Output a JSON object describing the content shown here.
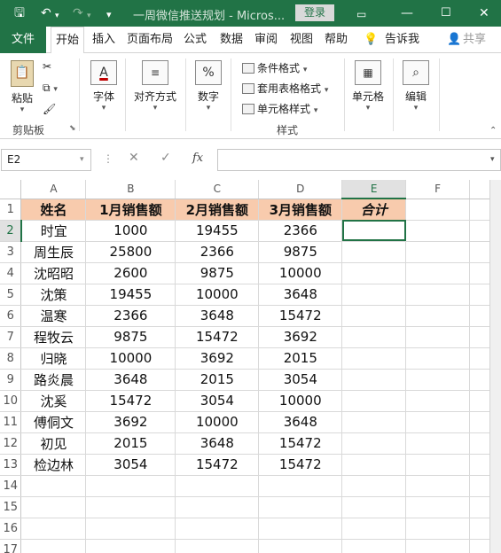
{
  "titlebar": {
    "title": "一周微信推送规划  -  Micros...",
    "login": "登录",
    "save_icon": "save-icon",
    "undo_icon": "undo-icon",
    "redo_icon": "redo-icon"
  },
  "tabs": {
    "file": "文件",
    "home": "开始",
    "insert": "插入",
    "page_layout": "页面布局",
    "formulas": "公式",
    "data": "数据",
    "review": "审阅",
    "view": "视图",
    "help": "帮助",
    "tell_me": "告诉我",
    "share": "共享"
  },
  "ribbon": {
    "paste": "粘贴",
    "clipboard": "剪贴板",
    "font": "字体",
    "alignment": "对齐方式",
    "number": "数字",
    "number_symbol": "%",
    "conditional_format": "条件格式",
    "table_format": "套用表格格式",
    "cell_styles": "单元格样式",
    "styles": "样式",
    "cells": "单元格",
    "editing": "编辑"
  },
  "formula_bar": {
    "name_box": "E2",
    "fx": "fx",
    "value": ""
  },
  "sheet": {
    "columns": [
      "A",
      "B",
      "C",
      "D",
      "E",
      "F"
    ],
    "header_row": [
      "姓名",
      "1月销售额",
      "2月销售额",
      "3月销售额",
      "合计"
    ],
    "rows": [
      [
        "时宜",
        "1000",
        "19455",
        "2366",
        ""
      ],
      [
        "周生辰",
        "25800",
        "2366",
        "9875",
        ""
      ],
      [
        "沈昭昭",
        "2600",
        "9875",
        "10000",
        ""
      ],
      [
        "沈策",
        "19455",
        "10000",
        "3648",
        ""
      ],
      [
        "温寒",
        "2366",
        "3648",
        "15472",
        ""
      ],
      [
        "程牧云",
        "9875",
        "15472",
        "3692",
        ""
      ],
      [
        "归晓",
        "10000",
        "3692",
        "2015",
        ""
      ],
      [
        "路炎晨",
        "3648",
        "2015",
        "3054",
        ""
      ],
      [
        "沈奚",
        "15472",
        "3054",
        "10000",
        ""
      ],
      [
        "傅侗文",
        "3692",
        "10000",
        "3648",
        ""
      ],
      [
        "初见",
        "2015",
        "3648",
        "15472",
        ""
      ],
      [
        "检边林",
        "3054",
        "15472",
        "15472",
        ""
      ]
    ],
    "row_numbers": [
      "1",
      "2",
      "3",
      "4",
      "5",
      "6",
      "7",
      "8",
      "9",
      "10",
      "11",
      "12",
      "13",
      "14",
      "15",
      "16",
      "17"
    ],
    "header_fill": "#f8cbad",
    "selection_color": "#217346"
  }
}
